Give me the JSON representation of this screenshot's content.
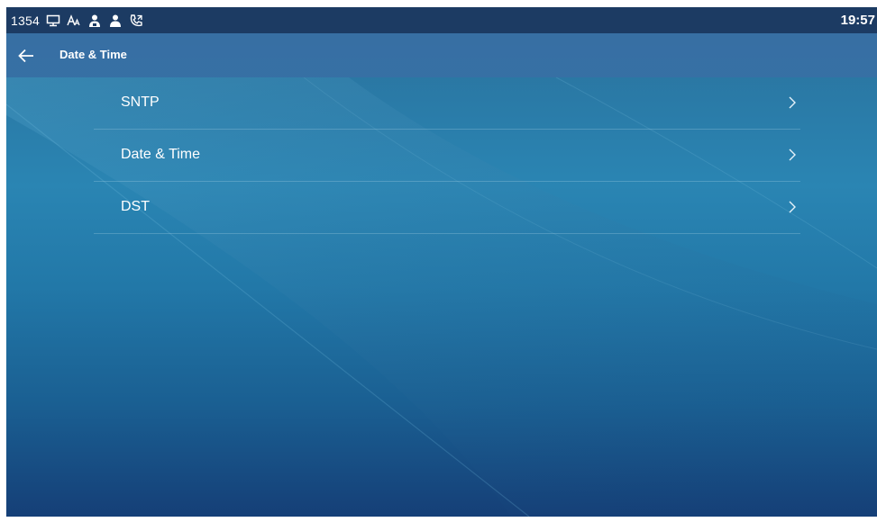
{
  "status_bar": {
    "account_number": "1354",
    "time": "19:57",
    "icons": [
      "computer-icon",
      "font-icon",
      "user-group-icon",
      "user-icon",
      "call-forward-icon"
    ]
  },
  "header": {
    "title": "Date & Time",
    "back_icon": "arrow-left-icon"
  },
  "menu": {
    "items": [
      {
        "label": "SNTP",
        "icon": "chevron-right-icon"
      },
      {
        "label": "Date & Time",
        "icon": "chevron-right-icon"
      },
      {
        "label": "DST",
        "icon": "chevron-right-icon"
      }
    ]
  },
  "colors": {
    "status_bar": "#1c3b63",
    "title_bar": "#3c6ea5",
    "background_top": "#2b6f9a",
    "background_bottom": "#153f77",
    "text": "#ffffff"
  }
}
